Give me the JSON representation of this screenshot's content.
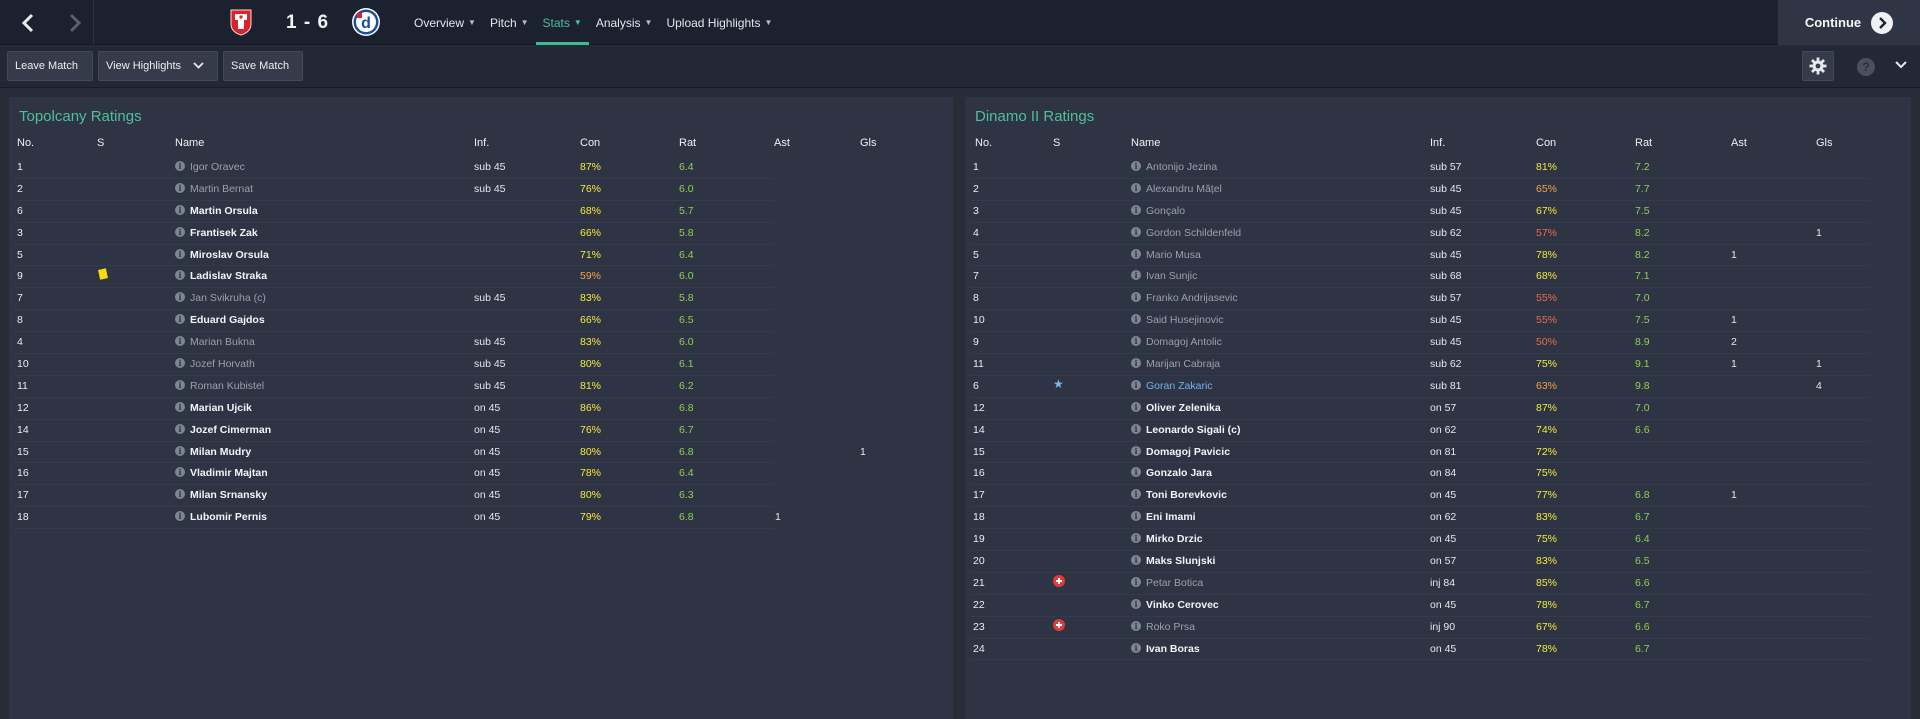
{
  "header": {
    "score": "1 - 6",
    "menu": [
      {
        "label": "Overview",
        "active": false
      },
      {
        "label": "Pitch",
        "active": false
      },
      {
        "label": "Stats",
        "active": true
      },
      {
        "label": "Analysis",
        "active": false
      },
      {
        "label": "Upload Highlights",
        "active": false
      }
    ],
    "continue_label": "Continue",
    "home_crest_colors": {
      "primary": "#d8232a",
      "secondary": "#ffffff"
    },
    "away_crest_colors": {
      "primary": "#1a4fa3",
      "secondary": "#ffffff",
      "accent": "#e31e24"
    }
  },
  "toolbar": {
    "leave_match": "Leave Match",
    "view_highlights": "View Highlights",
    "save_match": "Save Match",
    "help_glyph": "?"
  },
  "colors": {
    "accent": "#4fbf9b",
    "con_yellow": "#f4ea3b",
    "con_orange": "#f3a24a",
    "con_red": "#ef6a4f",
    "rating_green": "#8fd14f",
    "highlight_blue": "#6fb4ea"
  },
  "columns": {
    "no": "No.",
    "s": "S",
    "name": "Name",
    "inf": "Inf.",
    "con": "Con",
    "rat": "Rat",
    "ast": "Ast",
    "gls": "Gls"
  },
  "home": {
    "title": "Topolcany Ratings",
    "players": [
      {
        "no": "1",
        "s": "",
        "name": "Igor Oravec",
        "style": "sub",
        "inf": "sub 45",
        "con": "87%",
        "con_tone": "yellow",
        "rat": "6.4",
        "ast": "",
        "gls": ""
      },
      {
        "no": "2",
        "s": "",
        "name": "Martin Bernat",
        "style": "sub",
        "inf": "sub 45",
        "con": "76%",
        "con_tone": "yellow",
        "rat": "6.0",
        "ast": "",
        "gls": ""
      },
      {
        "no": "6",
        "s": "",
        "name": "Martin Orsula",
        "style": "bold",
        "inf": "",
        "con": "68%",
        "con_tone": "yellow",
        "rat": "5.7",
        "ast": "",
        "gls": ""
      },
      {
        "no": "3",
        "s": "",
        "name": "Frantisek Zak",
        "style": "bold",
        "inf": "",
        "con": "66%",
        "con_tone": "yellow",
        "rat": "5.8",
        "ast": "",
        "gls": ""
      },
      {
        "no": "5",
        "s": "",
        "name": "Miroslav Orsula",
        "style": "bold",
        "inf": "",
        "con": "71%",
        "con_tone": "yellow",
        "rat": "6.4",
        "ast": "",
        "gls": ""
      },
      {
        "no": "9",
        "s": "yellow-card",
        "name": "Ladislav Straka",
        "style": "bold",
        "inf": "",
        "con": "59%",
        "con_tone": "orange",
        "rat": "6.0",
        "ast": "",
        "gls": ""
      },
      {
        "no": "7",
        "s": "",
        "name": "Jan Svikruha (c)",
        "style": "sub",
        "inf": "sub 45",
        "con": "83%",
        "con_tone": "yellow",
        "rat": "5.8",
        "ast": "",
        "gls": ""
      },
      {
        "no": "8",
        "s": "",
        "name": "Eduard Gajdos",
        "style": "bold",
        "inf": "",
        "con": "66%",
        "con_tone": "yellow",
        "rat": "6.5",
        "ast": "",
        "gls": ""
      },
      {
        "no": "4",
        "s": "",
        "name": "Marian Bukna",
        "style": "sub",
        "inf": "sub 45",
        "con": "83%",
        "con_tone": "yellow",
        "rat": "6.0",
        "ast": "",
        "gls": ""
      },
      {
        "no": "10",
        "s": "",
        "name": "Jozef Horvath",
        "style": "sub",
        "inf": "sub 45",
        "con": "80%",
        "con_tone": "yellow",
        "rat": "6.1",
        "ast": "",
        "gls": ""
      },
      {
        "no": "11",
        "s": "",
        "name": "Roman Kubistel",
        "style": "sub",
        "inf": "sub 45",
        "con": "81%",
        "con_tone": "yellow",
        "rat": "6.2",
        "ast": "",
        "gls": ""
      },
      {
        "no": "12",
        "s": "",
        "name": "Marian Ujcik",
        "style": "bold",
        "inf": "on 45",
        "con": "86%",
        "con_tone": "yellow",
        "rat": "6.8",
        "ast": "",
        "gls": ""
      },
      {
        "no": "14",
        "s": "",
        "name": "Jozef Cimerman",
        "style": "bold",
        "inf": "on 45",
        "con": "76%",
        "con_tone": "yellow",
        "rat": "6.7",
        "ast": "",
        "gls": ""
      },
      {
        "no": "15",
        "s": "",
        "name": "Milan Mudry",
        "style": "bold",
        "inf": "on 45",
        "con": "80%",
        "con_tone": "yellow",
        "rat": "6.8",
        "ast": "",
        "gls": "1"
      },
      {
        "no": "16",
        "s": "",
        "name": "Vladimir Majtan",
        "style": "bold",
        "inf": "on 45",
        "con": "78%",
        "con_tone": "yellow",
        "rat": "6.4",
        "ast": "",
        "gls": ""
      },
      {
        "no": "17",
        "s": "",
        "name": "Milan Srnansky",
        "style": "bold",
        "inf": "on 45",
        "con": "80%",
        "con_tone": "yellow",
        "rat": "6.3",
        "ast": "",
        "gls": ""
      },
      {
        "no": "18",
        "s": "",
        "name": "Lubomir Pernis",
        "style": "bold",
        "inf": "on 45",
        "con": "79%",
        "con_tone": "yellow",
        "rat": "6.8",
        "ast": "1",
        "gls": ""
      }
    ]
  },
  "away": {
    "title": "Dinamo II Ratings",
    "players": [
      {
        "no": "1",
        "s": "",
        "name": "Antonijo Jezina",
        "style": "sub",
        "inf": "sub 57",
        "con": "81%",
        "con_tone": "yellow",
        "rat": "7.2",
        "ast": "",
        "gls": ""
      },
      {
        "no": "2",
        "s": "",
        "name": "Alexandru Mățel",
        "style": "sub",
        "inf": "sub 45",
        "con": "65%",
        "con_tone": "orange",
        "rat": "7.7",
        "ast": "",
        "gls": ""
      },
      {
        "no": "3",
        "s": "",
        "name": "Gonçalo",
        "style": "sub",
        "inf": "sub 45",
        "con": "67%",
        "con_tone": "yellow",
        "rat": "7.5",
        "ast": "",
        "gls": ""
      },
      {
        "no": "4",
        "s": "",
        "name": "Gordon Schildenfeld",
        "style": "sub",
        "inf": "sub 62",
        "con": "57%",
        "con_tone": "red",
        "rat": "8.2",
        "ast": "",
        "gls": "1"
      },
      {
        "no": "5",
        "s": "",
        "name": "Mario Musa",
        "style": "sub",
        "inf": "sub 45",
        "con": "78%",
        "con_tone": "yellow",
        "rat": "8.2",
        "ast": "1",
        "gls": ""
      },
      {
        "no": "7",
        "s": "",
        "name": "Ivan Sunjic",
        "style": "sub",
        "inf": "sub 68",
        "con": "68%",
        "con_tone": "yellow",
        "rat": "7.1",
        "ast": "",
        "gls": ""
      },
      {
        "no": "8",
        "s": "",
        "name": "Franko Andrijasevic",
        "style": "sub",
        "inf": "sub 57",
        "con": "55%",
        "con_tone": "red",
        "rat": "7.0",
        "ast": "",
        "gls": ""
      },
      {
        "no": "10",
        "s": "",
        "name": "Said Husejinovic",
        "style": "sub",
        "inf": "sub 45",
        "con": "55%",
        "con_tone": "red",
        "rat": "7.5",
        "ast": "1",
        "gls": ""
      },
      {
        "no": "9",
        "s": "",
        "name": "Domagoj Antolic",
        "style": "sub",
        "inf": "sub 45",
        "con": "50%",
        "con_tone": "red",
        "rat": "8.9",
        "ast": "2",
        "gls": ""
      },
      {
        "no": "11",
        "s": "",
        "name": "Marijan Cabraja",
        "style": "sub",
        "inf": "sub 62",
        "con": "75%",
        "con_tone": "yellow",
        "rat": "9.1",
        "ast": "1",
        "gls": "1"
      },
      {
        "no": "6",
        "s": "star",
        "name": "Goran Zakaric",
        "style": "hl",
        "inf": "sub 81",
        "con": "63%",
        "con_tone": "orange",
        "rat": "9.8",
        "ast": "",
        "gls": "4"
      },
      {
        "no": "12",
        "s": "",
        "name": "Oliver Zelenika",
        "style": "bold",
        "inf": "on 57",
        "con": "87%",
        "con_tone": "yellow",
        "rat": "7.0",
        "ast": "",
        "gls": ""
      },
      {
        "no": "14",
        "s": "",
        "name": "Leonardo Sigali (c)",
        "style": "bold",
        "inf": "on 62",
        "con": "74%",
        "con_tone": "yellow",
        "rat": "6.6",
        "ast": "",
        "gls": ""
      },
      {
        "no": "15",
        "s": "",
        "name": "Domagoj Pavicic",
        "style": "bold",
        "inf": "on 81",
        "con": "72%",
        "con_tone": "yellow",
        "rat": "",
        "ast": "",
        "gls": ""
      },
      {
        "no": "16",
        "s": "",
        "name": "Gonzalo Jara",
        "style": "bold",
        "inf": "on 84",
        "con": "75%",
        "con_tone": "yellow",
        "rat": "",
        "ast": "",
        "gls": ""
      },
      {
        "no": "17",
        "s": "",
        "name": "Toni Borevkovic",
        "style": "bold",
        "inf": "on 45",
        "con": "77%",
        "con_tone": "yellow",
        "rat": "6.8",
        "ast": "1",
        "gls": ""
      },
      {
        "no": "18",
        "s": "",
        "name": "Eni Imami",
        "style": "bold",
        "inf": "on 62",
        "con": "83%",
        "con_tone": "yellow",
        "rat": "6.7",
        "ast": "",
        "gls": ""
      },
      {
        "no": "19",
        "s": "",
        "name": "Mirko Drzic",
        "style": "bold",
        "inf": "on 45",
        "con": "75%",
        "con_tone": "yellow",
        "rat": "6.4",
        "ast": "",
        "gls": ""
      },
      {
        "no": "20",
        "s": "",
        "name": "Maks Slunjski",
        "style": "bold",
        "inf": "on 57",
        "con": "83%",
        "con_tone": "yellow",
        "rat": "6.5",
        "ast": "",
        "gls": ""
      },
      {
        "no": "21",
        "s": "injury",
        "name": "Petar Botica",
        "style": "sub",
        "inf": "inj 84",
        "con": "85%",
        "con_tone": "yellow",
        "rat": "6.6",
        "ast": "",
        "gls": ""
      },
      {
        "no": "22",
        "s": "",
        "name": "Vinko Cerovec",
        "style": "bold",
        "inf": "on 45",
        "con": "78%",
        "con_tone": "yellow",
        "rat": "6.7",
        "ast": "",
        "gls": ""
      },
      {
        "no": "23",
        "s": "injury",
        "name": "Roko Prsa",
        "style": "sub",
        "inf": "inj 90",
        "con": "67%",
        "con_tone": "yellow",
        "rat": "6.6",
        "ast": "",
        "gls": ""
      },
      {
        "no": "24",
        "s": "",
        "name": "Ivan Boras",
        "style": "bold",
        "inf": "on 45",
        "con": "78%",
        "con_tone": "yellow",
        "rat": "6.7",
        "ast": "",
        "gls": ""
      }
    ]
  }
}
